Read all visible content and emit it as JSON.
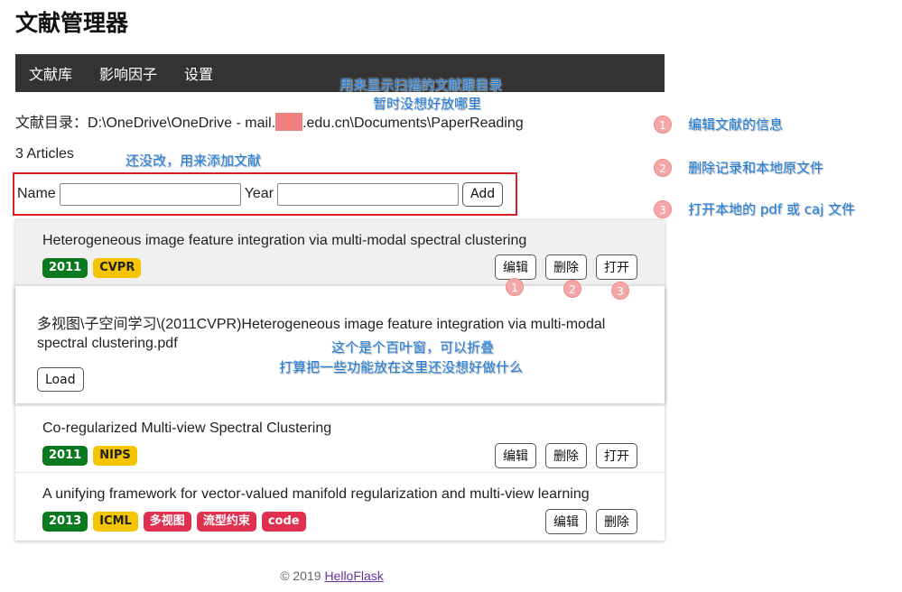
{
  "app": {
    "title": "文献管理器"
  },
  "nav": [
    "文献库",
    "影响因子",
    "设置"
  ],
  "directory": {
    "label": "文献目录：",
    "path_prefix": "D:\\OneDrive\\OneDrive - mail.",
    "path_suffix": ".edu.cn\\Documents\\PaperReading"
  },
  "count_text": "3 Articles",
  "form": {
    "name_label": "Name",
    "year_label": "Year",
    "add_label": "Add",
    "name_value": "",
    "year_value": ""
  },
  "articles": [
    {
      "title": "Heterogeneous image feature integration via multi-modal spectral clustering",
      "tags": [
        {
          "text": "2011",
          "color": "green"
        },
        {
          "text": "CVPR",
          "color": "yellow"
        }
      ],
      "actions": [
        "编辑",
        "删除",
        "打开"
      ]
    },
    {
      "title": "Co-regularized Multi-view Spectral Clustering",
      "tags": [
        {
          "text": "2011",
          "color": "green"
        },
        {
          "text": "NIPS",
          "color": "yellow"
        }
      ],
      "actions": [
        "编辑",
        "删除",
        "打开"
      ]
    },
    {
      "title": "A unifying framework for vector-valued manifold regularization and multi-view learning",
      "tags": [
        {
          "text": "2013",
          "color": "green"
        },
        {
          "text": "ICML",
          "color": "yellow"
        },
        {
          "text": "多视图",
          "color": "red"
        },
        {
          "text": "流型约束",
          "color": "red"
        },
        {
          "text": "code",
          "color": "red"
        }
      ],
      "actions": [
        "编辑",
        "删除"
      ]
    }
  ],
  "collapse": {
    "file_path": "多视图\\子空间学习\\(2011CVPR)Heterogeneous image feature integration via multi-modal spectral clustering.pdf",
    "load_label": "Load"
  },
  "annotations": {
    "nav_note_1": "用来显示扫描的文献跟目录",
    "nav_note_2": "暂时没想好放哪里",
    "form_note": "还没改，用来添加文献",
    "collapse_note_1": "这个是个百叶窗，可以折叠",
    "collapse_note_2": "打算把一些功能放在这里还没想好做什么",
    "legend": [
      {
        "num": "1",
        "text": "编辑文献的信息"
      },
      {
        "num": "2",
        "text": "删除记录和本地原文件"
      },
      {
        "num": "3",
        "text": "打开本地的 pdf 或 caj 文件"
      }
    ],
    "markers": [
      "1",
      "2",
      "3"
    ]
  },
  "footer": {
    "prefix": "© 2019 ",
    "link": "HelloFlask"
  },
  "colors": {
    "navbar": "#333333",
    "green_tag": "#0b7a1f",
    "yellow_tag": "#f5c400",
    "red_tag": "#e0304f",
    "annotation": "#1e7fe0"
  }
}
